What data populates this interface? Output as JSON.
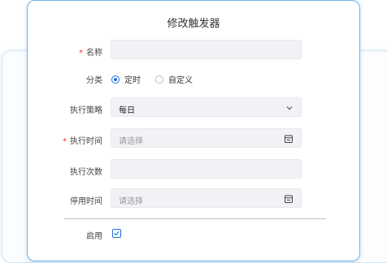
{
  "dialog": {
    "title": "修改触发器"
  },
  "form": {
    "name": {
      "label": "名称",
      "required": "*",
      "value": ""
    },
    "category": {
      "label": "分类",
      "options": [
        "定时",
        "自定义"
      ],
      "selected": "定时"
    },
    "strategy": {
      "label": "执行策略",
      "value": "每日"
    },
    "exec_time": {
      "label": "执行时间",
      "required": "*",
      "placeholder": "请选择"
    },
    "exec_count": {
      "label": "执行次数",
      "value": ""
    },
    "disable_time": {
      "label": "停用时间",
      "placeholder": "请选择"
    },
    "enabled": {
      "label": "启用",
      "checked": true
    }
  },
  "icons": {
    "calendar": "calendar-icon",
    "chevron": "chevron-down-icon",
    "check": "checkmark-icon"
  },
  "colors": {
    "accent": "#1e6fe0",
    "required": "#e33333",
    "dialog_border": "#6fb3e8"
  }
}
